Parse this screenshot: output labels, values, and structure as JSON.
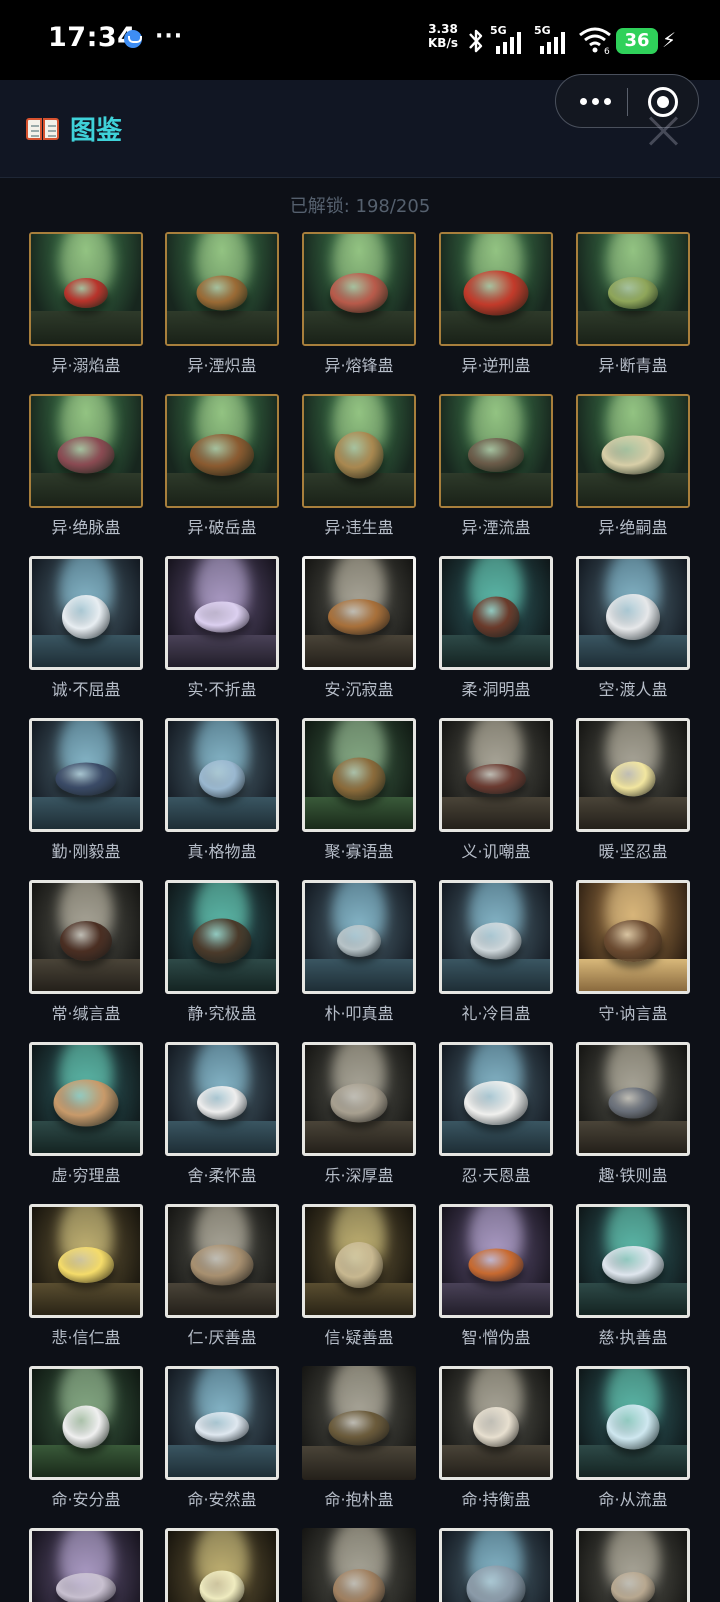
{
  "status_bar": {
    "time": "17:34",
    "more": "···",
    "speed_value": "3.38",
    "speed_unit": "KB/s",
    "sim1": "5G",
    "sim2": "5G",
    "wifi_badge": "6",
    "battery": "36",
    "icons": [
      "notification-icon",
      "bluetooth-icon",
      "signal-icon",
      "wifi-icon",
      "battery-icon",
      "charging-icon"
    ]
  },
  "header": {
    "title": "图鉴",
    "icon": "book-icon",
    "menu_icon": "more-dots-icon",
    "exit_icon": "target-icon",
    "close_icon": "close-icon"
  },
  "unlock_text": "已解锁: 198/205",
  "colors": {
    "title": "#3fd2d9",
    "background": "#0d1017",
    "header": "#111623",
    "gold_frame": "#a87f3c",
    "bone_frame": "#e6e6e2"
  },
  "items": [
    {
      "name": "异·溺焰蛊",
      "frame": "gold",
      "theme": "green",
      "creature": "#b8332b"
    },
    {
      "name": "异·湮炽蛊",
      "frame": "gold",
      "theme": "green",
      "creature": "#9a6a35"
    },
    {
      "name": "异·熔锋蛊",
      "frame": "gold",
      "theme": "green",
      "creature": "#b85a4a"
    },
    {
      "name": "异·逆刑蛊",
      "frame": "gold",
      "theme": "green",
      "creature": "#c23a2a"
    },
    {
      "name": "异·断青蛊",
      "frame": "gold",
      "theme": "green",
      "creature": "#8fa65a"
    },
    {
      "name": "异·绝脉蛊",
      "frame": "gold",
      "theme": "green",
      "creature": "#8a4a52"
    },
    {
      "name": "异·破岳蛊",
      "frame": "gold",
      "theme": "green",
      "creature": "#8a5a30"
    },
    {
      "name": "异·违生蛊",
      "frame": "gold",
      "theme": "green",
      "creature": "#a98850"
    },
    {
      "name": "异·湮流蛊",
      "frame": "gold",
      "theme": "green",
      "creature": "#6a5a48"
    },
    {
      "name": "异·绝嗣蛊",
      "frame": "gold",
      "theme": "green",
      "creature": "#d8cfa8"
    },
    {
      "name": "诚·不屈蛊",
      "frame": "bone",
      "theme": "ice",
      "creature": "#e8eef2"
    },
    {
      "name": "实·不折蛊",
      "frame": "bone",
      "theme": "violet",
      "creature": "#dcd0f0"
    },
    {
      "name": "安·沉寂蛊",
      "frame": "white",
      "theme": "stone",
      "creature": "#a8703a"
    },
    {
      "name": "柔·洞明蛊",
      "frame": "bone",
      "theme": "teal",
      "creature": "#6a3a2a"
    },
    {
      "name": "空·渡人蛊",
      "frame": "bone",
      "theme": "ice",
      "creature": "#e6e8ea"
    },
    {
      "name": "勤·刚毅蛊",
      "frame": "bone",
      "theme": "ice",
      "creature": "#3a4a66"
    },
    {
      "name": "真·格物蛊",
      "frame": "bone",
      "theme": "ice",
      "creature": "#9ab8d0"
    },
    {
      "name": "聚·寡语蛊",
      "frame": "bone",
      "theme": "moss",
      "creature": "#8a6a3a"
    },
    {
      "name": "义·讥嘲蛊",
      "frame": "bone",
      "theme": "stone",
      "creature": "#6a3a30"
    },
    {
      "name": "暖·坚忍蛊",
      "frame": "bone",
      "theme": "stone",
      "creature": "#f2e6a0"
    },
    {
      "name": "常·缄言蛊",
      "frame": "bone",
      "theme": "stone",
      "creature": "#4a2e22"
    },
    {
      "name": "静·究极蛊",
      "frame": "bone",
      "theme": "teal",
      "creature": "#4a3a2a"
    },
    {
      "name": "朴·叩真蛊",
      "frame": "bone",
      "theme": "ice",
      "creature": "#b8c4c8"
    },
    {
      "name": "礼·冷目蛊",
      "frame": "bone",
      "theme": "ice",
      "creature": "#cfd8dc"
    },
    {
      "name": "守·讷言蛊",
      "frame": "bone",
      "theme": "sand",
      "creature": "#6a4a30"
    },
    {
      "name": "虚·穷理蛊",
      "frame": "bone",
      "theme": "teal",
      "creature": "#c89a6a"
    },
    {
      "name": "舍·柔怀蛊",
      "frame": "bone",
      "theme": "ice",
      "creature": "#eeeeee"
    },
    {
      "name": "乐·深厚蛊",
      "frame": "bone",
      "theme": "stone",
      "creature": "#a8a090"
    },
    {
      "name": "忍·天恩蛊",
      "frame": "bone",
      "theme": "ice",
      "creature": "#f0f0ee"
    },
    {
      "name": "趣·铁则蛊",
      "frame": "bone",
      "theme": "stone",
      "creature": "#6a707a"
    },
    {
      "name": "悲·信仁蛊",
      "frame": "bone",
      "theme": "gold",
      "creature": "#f5dc6a"
    },
    {
      "name": "仁·厌善蛊",
      "frame": "bone",
      "theme": "stone",
      "creature": "#a89070"
    },
    {
      "name": "信·疑善蛊",
      "frame": "bone",
      "theme": "gold",
      "creature": "#c8b890"
    },
    {
      "name": "智·憎伪蛊",
      "frame": "bone",
      "theme": "violet",
      "creature": "#c86a30"
    },
    {
      "name": "慈·执善蛊",
      "frame": "bone",
      "theme": "teal",
      "creature": "#dfe6ee"
    },
    {
      "name": "命·安分蛊",
      "frame": "bone",
      "theme": "moss",
      "creature": "#f0f0f0"
    },
    {
      "name": "命·安然蛊",
      "frame": "bone",
      "theme": "ice",
      "creature": "#dfe8f0"
    },
    {
      "name": "命·抱朴蛊",
      "frame": "none",
      "theme": "stone",
      "creature": "#6a5a3a"
    },
    {
      "name": "命·持衡蛊",
      "frame": "bone",
      "theme": "stone",
      "creature": "#e8e0d0"
    },
    {
      "name": "命·从流蛊",
      "frame": "bone",
      "theme": "teal",
      "creature": "#cfe8f0"
    },
    {
      "name": "",
      "frame": "bone",
      "theme": "violet",
      "creature": "#c8c0d0"
    },
    {
      "name": "",
      "frame": "bone",
      "theme": "gold",
      "creature": "#f0ecc0"
    },
    {
      "name": "",
      "frame": "none",
      "theme": "stone",
      "creature": "#a08060"
    },
    {
      "name": "",
      "frame": "bone",
      "theme": "ice",
      "creature": "#8a9aa8"
    },
    {
      "name": "",
      "frame": "bone",
      "theme": "stone",
      "creature": "#b8a890"
    }
  ]
}
